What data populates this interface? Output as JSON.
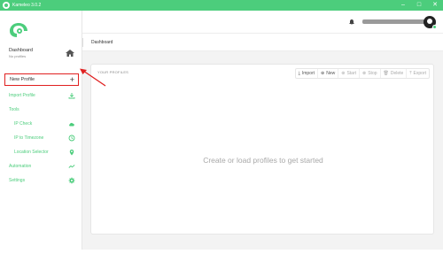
{
  "window": {
    "title": "Kameleo 3.0.2"
  },
  "sidebar": {
    "dashboard": {
      "title": "Dashboard",
      "subtitle": "No profiles"
    },
    "new_profile": {
      "label": "New Profile"
    },
    "items": [
      {
        "label": "Import Profile",
        "icon": "import-icon"
      },
      {
        "label": "Tools",
        "icon": ""
      },
      {
        "label": "IP Check",
        "icon": "cloud-icon"
      },
      {
        "label": "IP to Timezone",
        "icon": "clock-icon"
      },
      {
        "label": "Location Selector",
        "icon": "pin-icon"
      },
      {
        "label": "Automation",
        "icon": "graph-icon"
      },
      {
        "label": "Settings",
        "icon": "gear-icon"
      }
    ]
  },
  "breadcrumb": {
    "current": "Dashboard"
  },
  "main": {
    "panel_title": "YOUR PROFILES",
    "toolbar": {
      "import": "Import",
      "new": "New",
      "start": "Start",
      "stop": "Stop",
      "delete": "Delete",
      "export": "Export"
    },
    "empty_message": "Create or load profiles to get started"
  },
  "colors": {
    "accent": "#4ccd7c",
    "highlight": "#e02020"
  }
}
